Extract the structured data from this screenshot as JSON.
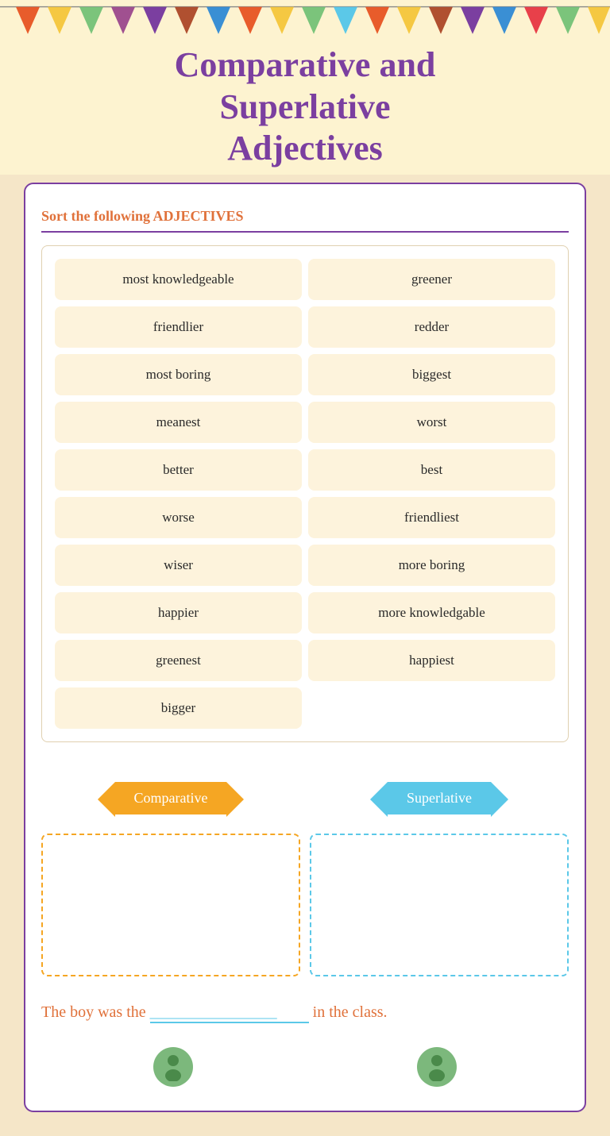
{
  "header": {
    "title_line1": "Comparative and",
    "title_line2": "Superlative",
    "title_line3": "Adjectives"
  },
  "sort_section": {
    "instruction": "Sort the following ADJECTIVES",
    "words": [
      {
        "id": 1,
        "text": "most knowledgeable",
        "col": 0
      },
      {
        "id": 2,
        "text": "greener",
        "col": 1
      },
      {
        "id": 3,
        "text": "friendlier",
        "col": 0
      },
      {
        "id": 4,
        "text": "redder",
        "col": 1
      },
      {
        "id": 5,
        "text": "most boring",
        "col": 0
      },
      {
        "id": 6,
        "text": "biggest",
        "col": 1
      },
      {
        "id": 7,
        "text": "meanest",
        "col": 0
      },
      {
        "id": 8,
        "text": "worst",
        "col": 1
      },
      {
        "id": 9,
        "text": "better",
        "col": 0
      },
      {
        "id": 10,
        "text": "best",
        "col": 1
      },
      {
        "id": 11,
        "text": "worse",
        "col": 0
      },
      {
        "id": 12,
        "text": "friendliest",
        "col": 1
      },
      {
        "id": 13,
        "text": "wiser",
        "col": 0
      },
      {
        "id": 14,
        "text": "more boring",
        "col": 1
      },
      {
        "id": 15,
        "text": "happier",
        "col": 0
      },
      {
        "id": 16,
        "text": "more knowledgable",
        "col": 1
      },
      {
        "id": 17,
        "text": "greenest",
        "col": 0
      },
      {
        "id": 18,
        "text": "happiest",
        "col": 1
      },
      {
        "id": 19,
        "text": "bigger",
        "col": 0
      }
    ]
  },
  "category_boxes": {
    "comparative_label": "Comparative",
    "superlative_label": "Superlative"
  },
  "sentence": {
    "text_before": "The boy was the",
    "blank": "________________",
    "text_after": "in the class."
  },
  "colors": {
    "purple": "#7b3fa0",
    "orange": "#e0713a",
    "gold": "#f5a623",
    "blue": "#5bc8e8",
    "cream": "#fdf3dc",
    "bg": "#f5e6c8"
  },
  "bunting": {
    "flag_colors": [
      "#e85c2b",
      "#f5c842",
      "#7bc47b",
      "#7b3fa0",
      "#3a8fd4",
      "#e85c2b",
      "#f5c842",
      "#7bc47b",
      "#3a8fd4",
      "#e85c2b",
      "#f5c842",
      "#b05030",
      "#3a8fd4",
      "#e8404a",
      "#7b3fa0"
    ]
  }
}
